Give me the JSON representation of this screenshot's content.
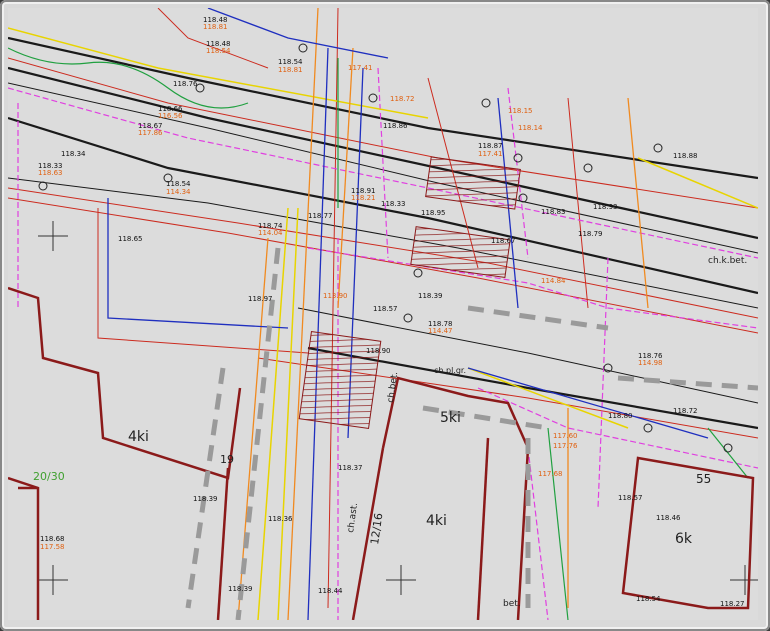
{
  "map": {
    "building_labels": [
      "4ki",
      "5ki",
      "4ki",
      "6k",
      "55"
    ],
    "parcel_label": "20/30",
    "street_labels": [
      "12/16",
      "19",
      "ch.k.bet.",
      "ch.pl.gr.",
      "bet.",
      "ch.ast.",
      "ch.bet."
    ],
    "elevations_black": [
      "118.48",
      "118.54",
      "118.76",
      "118.66",
      "118.67",
      "118.54",
      "118.34",
      "118.33",
      "118.65",
      "118.97",
      "118.74",
      "118.77",
      "118.91",
      "118.33",
      "118.95",
      "118.86",
      "118.88",
      "118.93",
      "118.79",
      "118.83",
      "118.67",
      "118.90",
      "118.78",
      "118.57",
      "118.39",
      "118.36",
      "118.37",
      "118.39",
      "118.44",
      "118.54",
      "118.27",
      "118.46",
      "118.57",
      "118.39",
      "118.68",
      "118.80",
      "118.72",
      "118.76",
      "118.87"
    ],
    "elevations_orange": [
      "118.81",
      "117.41",
      "118.72",
      "116.56",
      "117.86",
      "118.54",
      "118.63",
      "114.34",
      "114.04",
      "113.90",
      "114.47",
      "117.58",
      "114.98",
      "118.21",
      "114.84",
      "117.60",
      "117.68",
      "118.15",
      "117.76",
      "118.14",
      "117.41"
    ],
    "colors": {
      "background": "#dcdcdc",
      "building": "#8b1a1a",
      "road": "#222222",
      "gas": "#e0d000",
      "telecom": "#e040e0",
      "power": "#d03020",
      "water": "#2030c0",
      "sewer": "#f08020",
      "heat": "#20a040"
    }
  }
}
